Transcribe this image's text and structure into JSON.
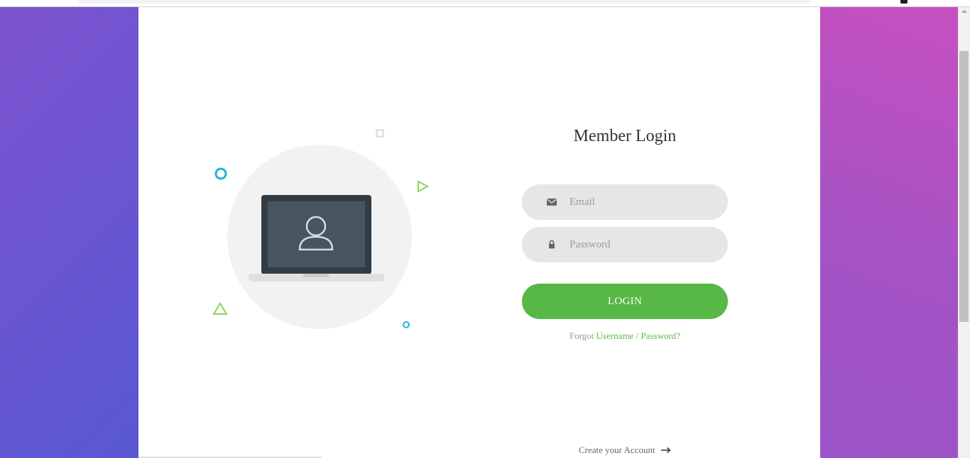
{
  "colors": {
    "accent": "#57b846",
    "input_bg": "#e6e6e6",
    "deco_blue": "#1ab4d6",
    "deco_green": "#8cd166"
  },
  "login": {
    "title": "Member Login",
    "email_placeholder": "Email",
    "password_placeholder": "Password",
    "email_icon": "envelope-icon",
    "password_icon": "lock-icon",
    "button_label": "LOGIN",
    "forgot_prefix": "Forgot",
    "forgot_username": "Username",
    "forgot_separator": "/",
    "forgot_password": "Password?"
  },
  "footer": {
    "create_account": "Create your Account",
    "arrow_icon": "arrow-right-icon"
  },
  "illustration": {
    "icon": "laptop-user-icon"
  }
}
